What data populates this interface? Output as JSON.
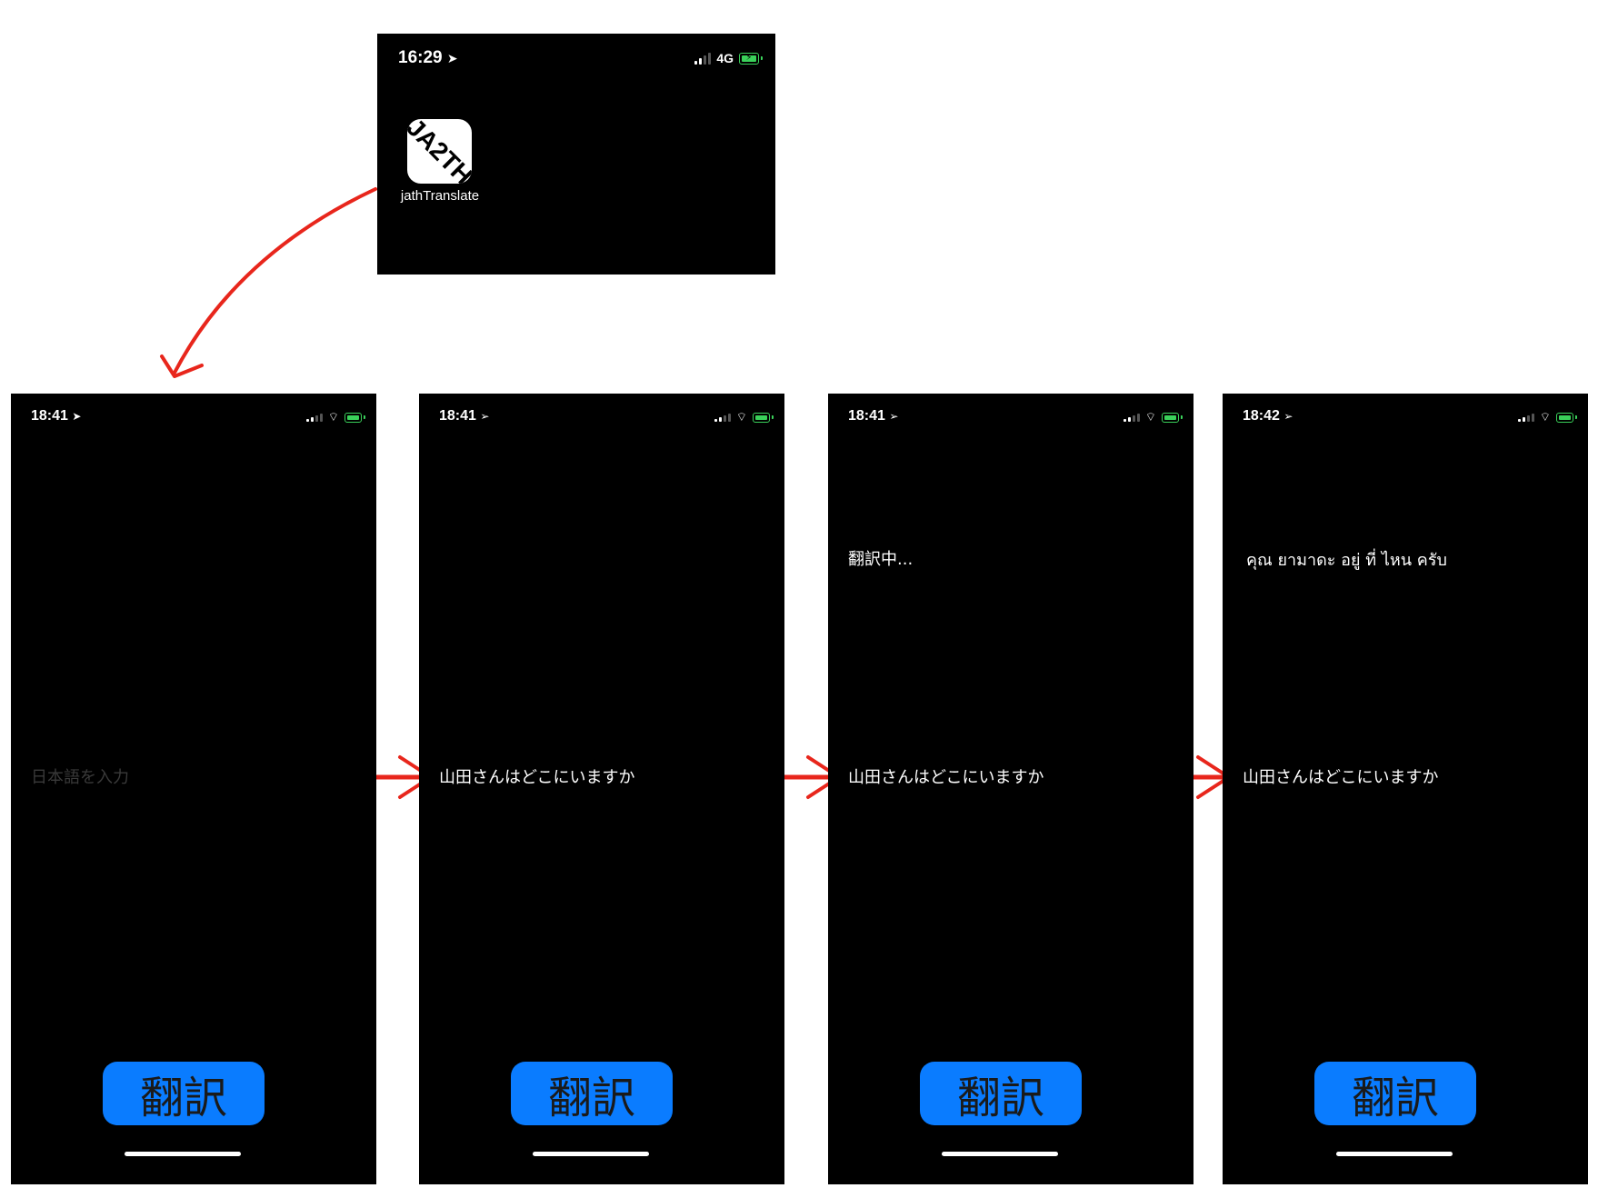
{
  "home_screen": {
    "time": "16:29",
    "network": "4G",
    "app_icon_text": "JA2TH",
    "app_name": "jathTranslate"
  },
  "screens": [
    {
      "time": "18:41",
      "input_value": "",
      "input_placeholder": "日本語を入力",
      "result_text": "",
      "button_label": "翻訳"
    },
    {
      "time": "18:41",
      "input_value": "山田さんはどこにいますか",
      "input_placeholder": "日本語を入力",
      "result_text": "",
      "button_label": "翻訳"
    },
    {
      "time": "18:41",
      "input_value": "山田さんはどこにいますか",
      "input_placeholder": "日本語を入力",
      "result_text": "翻訳中...",
      "button_label": "翻訳"
    },
    {
      "time": "18:42",
      "input_value": "山田さんはどこにいますか",
      "input_placeholder": "日本語を入力",
      "result_text": "คุณ ยามาดะ อยู่ ที่ ไหน ครับ",
      "button_label": "翻訳"
    }
  ],
  "colors": {
    "button": "#0a7cff",
    "battery": "#3ad15a",
    "annotation_arrow": "#e8261c",
    "screen_bg": "#000000"
  },
  "icons": [
    "location-arrow-icon",
    "signal-icon",
    "wifi-icon",
    "battery-charging-icon",
    "app-icon"
  ]
}
